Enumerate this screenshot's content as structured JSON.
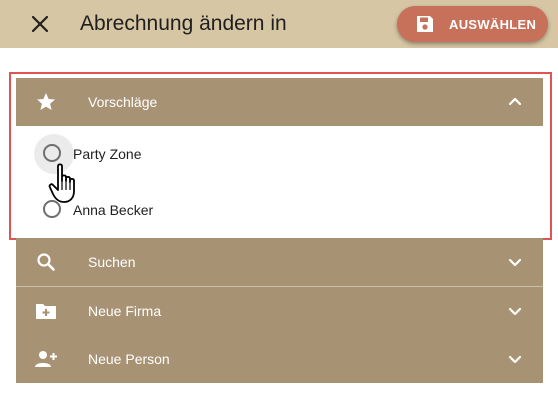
{
  "header": {
    "title": "Abrechnung ändern in",
    "select_label": "AUSWÄHLEN",
    "close_icon": "close-icon",
    "save_icon": "floppy-disk-icon"
  },
  "panels": {
    "suggestions": {
      "label": "Vorschläge",
      "icon": "star-icon",
      "expanded": true,
      "options": [
        {
          "label": "Party Zone",
          "selected": false
        },
        {
          "label": "Anna Becker",
          "selected": false
        }
      ]
    },
    "search": {
      "label": "Suchen",
      "icon": "search-icon",
      "expanded": false
    },
    "new_company": {
      "label": "Neue Firma",
      "icon": "add-folder-icon",
      "expanded": false
    },
    "new_person": {
      "label": "Neue Person",
      "icon": "add-person-icon",
      "expanded": false
    }
  },
  "colors": {
    "topbar": "#d7c6a4",
    "panel": "#a89274",
    "accent_button": "#c7705a",
    "highlight_border": "#e05454"
  }
}
